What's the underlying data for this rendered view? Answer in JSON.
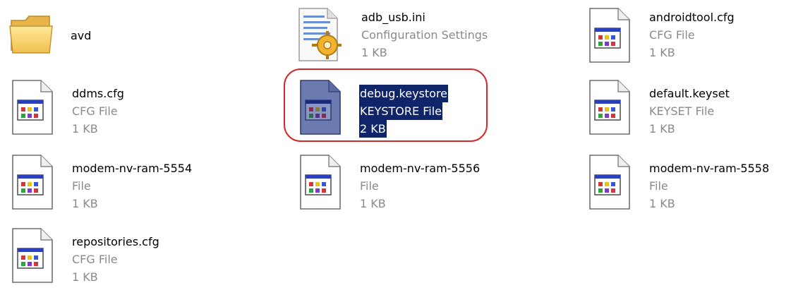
{
  "items": [
    {
      "name": "avd",
      "type": "",
      "size": "",
      "icon": "folder-icon"
    },
    {
      "name": "adb_usb.ini",
      "type": "Configuration Settings",
      "size": "1 KB",
      "icon": "config-settings-icon"
    },
    {
      "name": "androidtool.cfg",
      "type": "CFG File",
      "size": "1 KB",
      "icon": "generic-file-icon"
    },
    {
      "name": "ddms.cfg",
      "type": "CFG File",
      "size": "1 KB",
      "icon": "generic-file-icon"
    },
    {
      "name": "debug.keystore",
      "type": "KEYSTORE File",
      "size": "2 KB",
      "icon": "generic-file-icon",
      "selected": true
    },
    {
      "name": "default.keyset",
      "type": "KEYSET File",
      "size": "1 KB",
      "icon": "generic-file-icon"
    },
    {
      "name": "modem-nv-ram-5554",
      "type": "File",
      "size": "1 KB",
      "icon": "generic-file-icon"
    },
    {
      "name": "modem-nv-ram-5556",
      "type": "File",
      "size": "1 KB",
      "icon": "generic-file-icon"
    },
    {
      "name": "modem-nv-ram-5558",
      "type": "File",
      "size": "1 KB",
      "icon": "generic-file-icon"
    },
    {
      "name": "repositories.cfg",
      "type": "CFG File",
      "size": "1 KB",
      "icon": "generic-file-icon"
    }
  ],
  "colors": {
    "selection_bg": "#10246a",
    "selection_text": "#ffffff",
    "sub_text": "#8a8a8a",
    "highlight_ring": "#d22a2a"
  }
}
